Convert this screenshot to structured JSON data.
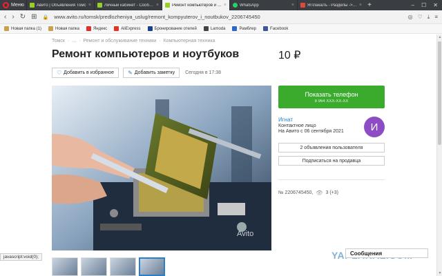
{
  "browser": {
    "menu_label": "Меню",
    "tabs": [
      {
        "label": "Авито | Объявления Томс",
        "favicon_color": "#97cf26",
        "active": false
      },
      {
        "label": "Личный кабинет - Сообщен",
        "favicon_color": "#97cf26",
        "active": false
      },
      {
        "label": "Ремонт компьютеров и ноу",
        "favicon_color": "#97cf26",
        "active": true
      },
      {
        "label": "WhatsApp",
        "favicon_color": "#25d366",
        "active": false
      },
      {
        "label": "ЯПлакалъ - Разделы -> Со",
        "favicon_color": "#d94b3a",
        "active": false
      }
    ],
    "url": "www.avito.ru/tomsk/predlozheniya_uslug/remont_kompyuterov_i_noutbukov_2206745450",
    "bookmarks": [
      {
        "label": "Новая папка (1)",
        "color": "#c8a24a"
      },
      {
        "label": "Новая папка",
        "color": "#c8a24a"
      },
      {
        "label": "Яндекс",
        "color": "#e0302a"
      },
      {
        "label": "AliExpress",
        "color": "#e43225"
      },
      {
        "label": "Бронирование отелей",
        "color": "#1a3f8c"
      },
      {
        "label": "Lamoda",
        "color": "#444444"
      },
      {
        "label": "Рамблер",
        "color": "#2d67c9"
      },
      {
        "label": "Facebook",
        "color": "#3b5998"
      }
    ]
  },
  "page": {
    "breadcrumb": [
      "Томск",
      "·",
      "...",
      "·",
      "Ремонт и обслуживание техники",
      "·",
      "Компьютерная техника"
    ],
    "title": "Ремонт компьютеров и ноутбуков",
    "price": "10 ₽",
    "favorite_label": "Добавить в избранное",
    "note_label": "Добавить заметку",
    "date": "Сегодня в 17:38",
    "phone_button": "Показать телефон",
    "phone_masked": "8 964 XXX-XX-XX",
    "seller": {
      "name": "Игнат",
      "role": "Контактное лицо",
      "since": "На Авито с 06 сентября 2021",
      "avatar_letter": "И",
      "avatar_color": "#8e4bc6"
    },
    "user_ads": "2 объявления пользователя",
    "subscribe": "Подписаться на продавца",
    "ad_number": "№ 2206745450,",
    "views": "3 (+3)",
    "photo_watermark": "Avito",
    "accent_green": "#3aab2c",
    "accent_blue": "#2a7fc8"
  },
  "status_text": "javascript:void(0);",
  "messages_label": "Сообщения",
  "site_watermark": "YAPLAKAL.COM"
}
